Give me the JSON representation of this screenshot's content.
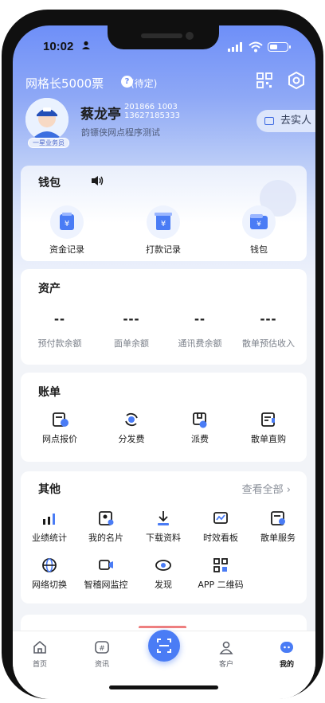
{
  "status_bar": {
    "time": "10:02",
    "battery_level": 0.45
  },
  "header": {
    "title": "网格长5000票",
    "help": "?",
    "pending": "(待定)"
  },
  "profile": {
    "badge": "一星业务员",
    "name": "蔡龙亭",
    "id_line1": "201866  1003",
    "id_line2": "13627185333",
    "subtitle": "韵镖侠网点程序测试",
    "verify_label": "去实人"
  },
  "wallet": {
    "title": "钱包",
    "items": [
      {
        "label": "资金记录",
        "icon": "fund-record-icon"
      },
      {
        "label": "打款记录",
        "icon": "payment-record-icon"
      },
      {
        "label": "钱包",
        "icon": "wallet-icon"
      }
    ]
  },
  "assets": {
    "title": "资产",
    "items": [
      {
        "value": "--",
        "label": "预付款余额"
      },
      {
        "value": "---",
        "label": "面单余额"
      },
      {
        "value": "--",
        "label": "通讯费余额"
      },
      {
        "value": "---",
        "label": "散单预估收入"
      }
    ]
  },
  "bills": {
    "title": "账单",
    "items": [
      {
        "label": "网点报价",
        "icon": "quote-icon"
      },
      {
        "label": "分发费",
        "icon": "distribution-icon"
      },
      {
        "label": "派费",
        "icon": "delivery-fee-icon"
      },
      {
        "label": "散单直购",
        "icon": "direct-purchase-icon"
      }
    ]
  },
  "other": {
    "title": "其他",
    "more": "查看全部",
    "items": [
      {
        "label": "业绩统计",
        "icon": "stats-icon"
      },
      {
        "label": "我的名片",
        "icon": "card-icon"
      },
      {
        "label": "下载资料",
        "icon": "download-icon"
      },
      {
        "label": "时效看板",
        "icon": "dashboard-icon"
      },
      {
        "label": "散单服务",
        "icon": "service-icon"
      },
      {
        "label": "网络切换",
        "icon": "globe-icon"
      },
      {
        "label": "智稽网监控",
        "icon": "monitor-icon"
      },
      {
        "label": "发现",
        "icon": "discover-icon"
      },
      {
        "label": "APP 二维码",
        "icon": "qr-code-icon"
      }
    ]
  },
  "tabbar": {
    "items": [
      {
        "label": "首页",
        "icon": "home-icon"
      },
      {
        "label": "资讯",
        "icon": "news-icon"
      },
      {
        "label": "",
        "icon": "scan-icon"
      },
      {
        "label": "客户",
        "icon": "customer-icon"
      },
      {
        "label": "我的",
        "icon": "profile-icon"
      }
    ],
    "active": "我的"
  },
  "colors": {
    "accent": "#4a7cf5",
    "header_gradient_top": "#6e8ff8"
  }
}
